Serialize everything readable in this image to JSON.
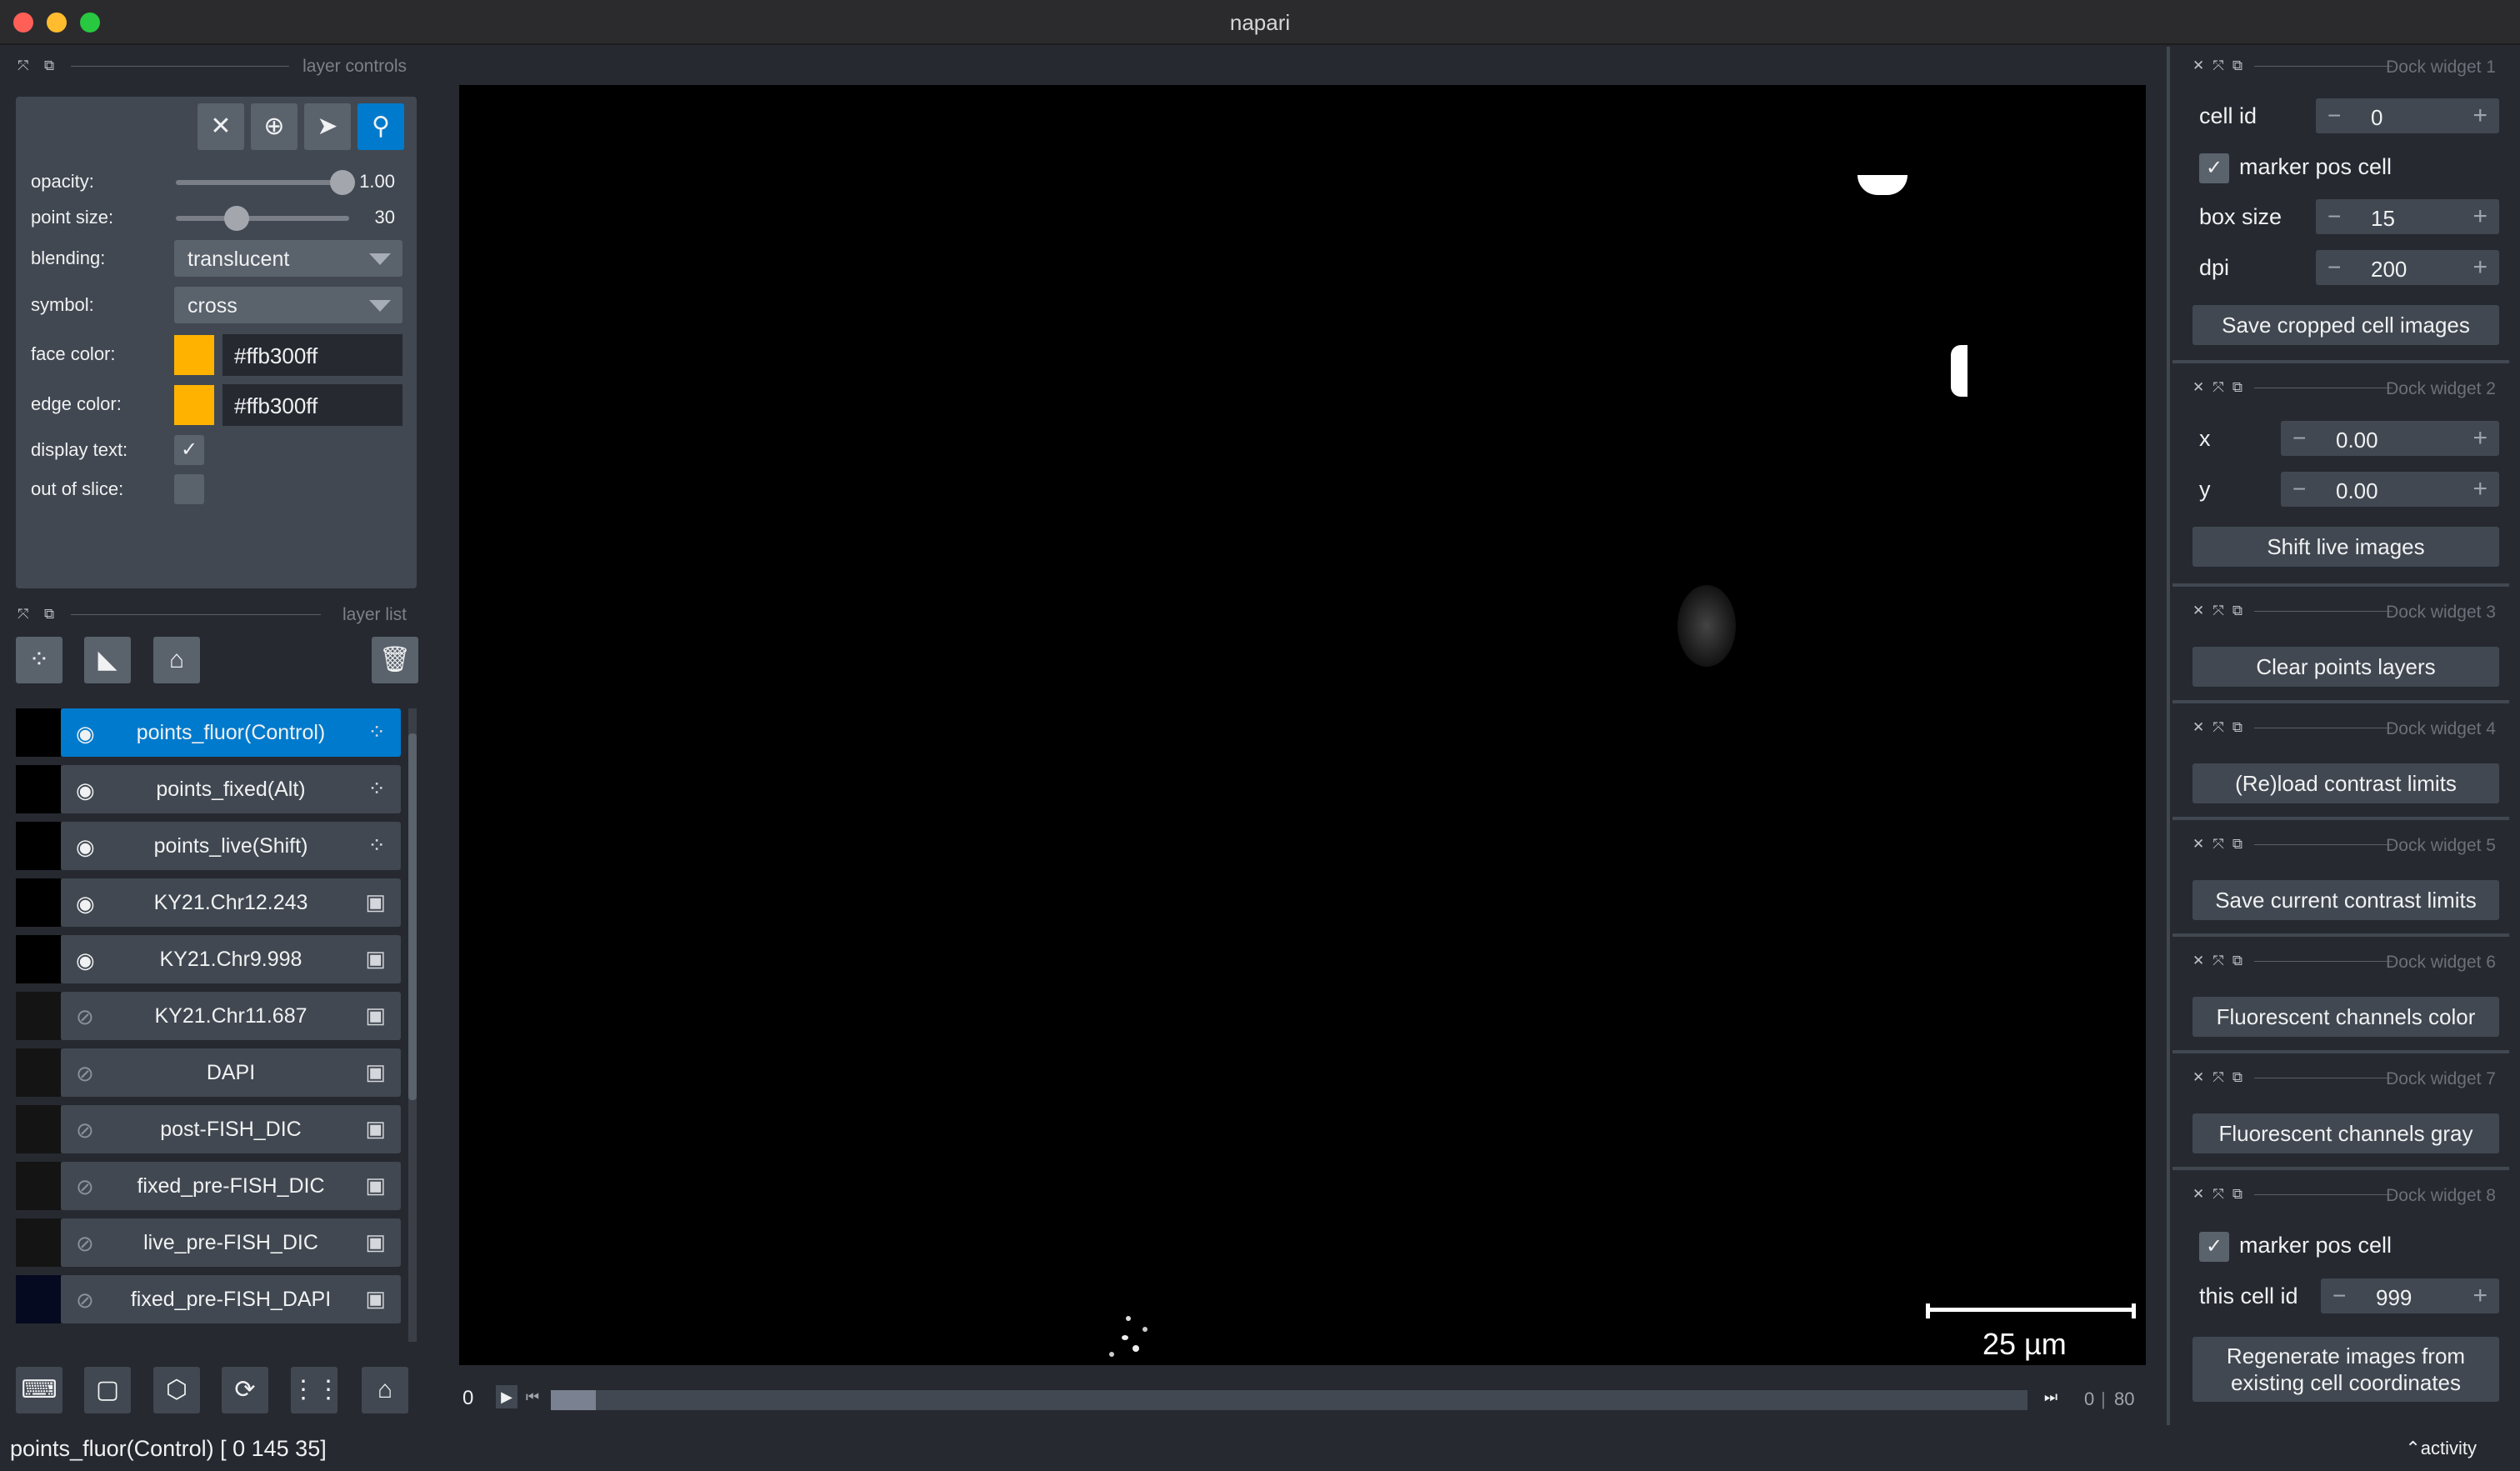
{
  "app": {
    "title": "napari"
  },
  "layer_controls": {
    "header": "layer controls",
    "opacity_label": "opacity:",
    "opacity_value": "1.00",
    "opacity_level": 1.0,
    "point_size_label": "point size:",
    "point_size_value": "30",
    "point_size_level": 0.35,
    "blending_label": "blending:",
    "blending_value": "translucent",
    "symbol_label": "symbol:",
    "symbol_value": "cross",
    "face_color_label": "face color:",
    "face_color_value": "#ffb300ff",
    "edge_color_label": "edge color:",
    "edge_color_value": "#ffb300ff",
    "display_text_label": "display text:",
    "display_text_checked": true,
    "out_of_slice_label": "out of slice:",
    "out_of_slice_checked": false,
    "swatch_color": "#ffb300"
  },
  "layer_list": {
    "header": "layer list",
    "layers": [
      {
        "name": "points_fluor(Control)",
        "visible": true,
        "type": "points",
        "selected": true
      },
      {
        "name": "points_fixed(Alt)",
        "visible": true,
        "type": "points"
      },
      {
        "name": "points_live(Shift)",
        "visible": true,
        "type": "points"
      },
      {
        "name": "KY21.Chr12.243",
        "visible": true,
        "type": "image"
      },
      {
        "name": "KY21.Chr9.998",
        "visible": true,
        "type": "image"
      },
      {
        "name": "KY21.Chr11.687",
        "visible": false,
        "type": "image"
      },
      {
        "name": "DAPI",
        "visible": false,
        "type": "image"
      },
      {
        "name": "post-FISH_DIC",
        "visible": false,
        "type": "image"
      },
      {
        "name": "fixed_pre-FISH_DIC",
        "visible": false,
        "type": "image"
      },
      {
        "name": "live_pre-FISH_DIC",
        "visible": false,
        "type": "image"
      },
      {
        "name": "fixed_pre-FISH_DAPI",
        "visible": false,
        "type": "image"
      }
    ]
  },
  "canvas": {
    "scale_bar_label": "25 µm"
  },
  "dims": {
    "current": "0",
    "position": "0",
    "max": "80",
    "progress": 0.0
  },
  "dock": {
    "w1": {
      "title": "Dock widget 1",
      "cell_id_label": "cell id",
      "cell_id": "0",
      "marker_label": "marker pos cell",
      "marker_checked": true,
      "box_size_label": "box size",
      "box_size": "15",
      "dpi_label": "dpi",
      "dpi": "200",
      "button": "Save cropped cell images"
    },
    "w2": {
      "title": "Dock widget 2",
      "x_label": "x",
      "x": "0.00",
      "y_label": "y",
      "y": "0.00",
      "button": "Shift live images"
    },
    "w3": {
      "title": "Dock widget 3",
      "button": "Clear points layers"
    },
    "w4": {
      "title": "Dock widget 4",
      "button": "(Re)load contrast limits"
    },
    "w5": {
      "title": "Dock widget 5",
      "button": "Save current contrast limits"
    },
    "w6": {
      "title": "Dock widget 6",
      "button": "Fluorescent channels color"
    },
    "w7": {
      "title": "Dock widget 7",
      "button": "Fluorescent channels gray"
    },
    "w8": {
      "title": "Dock widget 8",
      "marker_label": "marker pos cell",
      "marker_checked": true,
      "cell_label": "this cell id",
      "cell_id": "999",
      "button_line1": "Regenerate images from",
      "button_line2": "existing cell coordinates"
    }
  },
  "status": {
    "text": "points_fluor(Control) [  0 145  35]",
    "activity": "activity"
  },
  "colors": {
    "accent": "#007acc",
    "background": "#262930",
    "panel": "#414851",
    "highlight": "#ffb300"
  }
}
